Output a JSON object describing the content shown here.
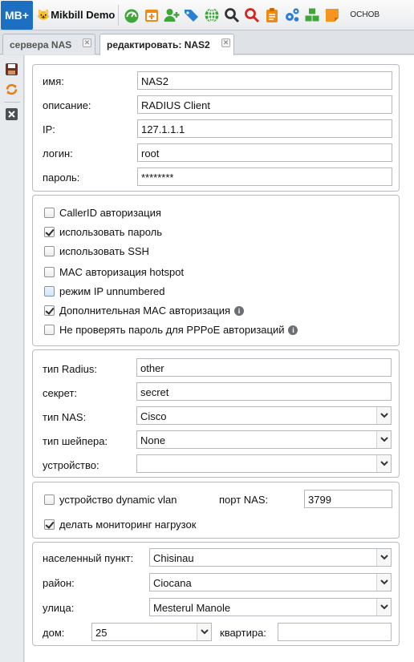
{
  "app": {
    "logo": "MB+",
    "brand_icon": "cat-emoji",
    "brand_name": "Mikbill Demo",
    "menu_text": "ОСНОВ"
  },
  "toolbar_icons": [
    "dashboard-icon",
    "calendar-add-icon",
    "user-add-icon",
    "tags-icon",
    "globe-icon",
    "search-icon",
    "search-red-icon",
    "clipboard-icon",
    "gears-icon",
    "cubes-icon",
    "sticky-note-icon"
  ],
  "tabs": [
    {
      "label": "сервера NAS"
    },
    {
      "label": "редактировать: NAS2"
    }
  ],
  "sidebar_icons": [
    "save-icon",
    "refresh-icon",
    "close-icon"
  ],
  "general": {
    "name_label": "имя:",
    "name_value": "NAS2",
    "description_label": "описание:",
    "description_value": "RADIUS Client",
    "ip_label": "IP:",
    "ip_value": "127.1.1.1",
    "login_label": "логин:",
    "login_value": "root",
    "password_label": "пароль:",
    "password_value": "********"
  },
  "options": [
    {
      "label": "CallerID авторизация",
      "checked": false
    },
    {
      "label": "использовать пароль",
      "checked": true
    },
    {
      "label": "использовать SSH",
      "checked": false
    },
    {
      "label": "MAC авторизация hotspot",
      "checked": false
    },
    {
      "label": "режим IP unnumbered",
      "checked": false
    },
    {
      "label": "Дополнительная MAC авторизация",
      "checked": true
    },
    {
      "label": "Не проверять пароль для PPPoE авторизаций",
      "checked": false
    }
  ],
  "radius": {
    "type_label": "тип Radius:",
    "type_value": "other",
    "secret_label": "секрет:",
    "secret_value": "secret",
    "nas_type_label": "тип NAS:",
    "nas_type_value": "Cisco",
    "shaper_label": "тип шейпера:",
    "shaper_value": "None",
    "device_label": "устройство:",
    "device_value": ""
  },
  "vlan": {
    "dynamic_vlan_label": "устройство dynamic vlan",
    "dynamic_vlan_checked": false,
    "port_label": "порт NAS:",
    "port_value": "3799",
    "monitoring_label": "делать мониторинг нагрузок",
    "monitoring_checked": true
  },
  "address": {
    "city_label": "населенный пункт:",
    "city_value": "Chisinau",
    "district_label": "район:",
    "district_value": "Ciocana",
    "street_label": "улица:",
    "street_value": "Mesterul Manole",
    "house_label": "дом:",
    "house_value": "25",
    "apartment_label": "квартира:",
    "apartment_value": ""
  },
  "colors": {
    "accent": "#1d6fc1",
    "border": "#b8bcc2",
    "background": "#dfe3e8"
  }
}
